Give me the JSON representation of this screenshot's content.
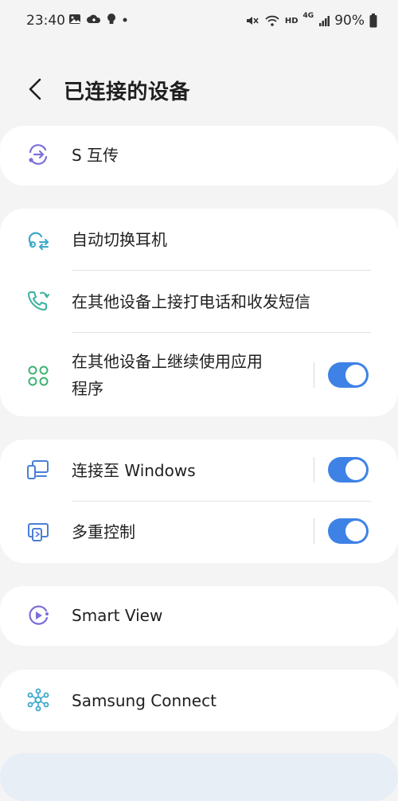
{
  "status_bar": {
    "time": "23:40",
    "battery": "90%",
    "signal_tag": "4G",
    "hd_tag": "HD"
  },
  "header": {
    "title": "已连接的设备"
  },
  "items": {
    "s_transfer": {
      "label": "S 互传"
    },
    "auto_switch": {
      "label": "自动切换耳机"
    },
    "calls_texts": {
      "label": "在其他设备上接打电话和收发短信"
    },
    "continue_apps": {
      "label_line1": "在其他设备上继续使用应用",
      "label_line2": "程序",
      "enabled": true
    },
    "link_windows": {
      "label": "连接至 Windows",
      "enabled": true
    },
    "multi_control": {
      "label": "多重控制",
      "enabled": true
    },
    "smart_view": {
      "label": "Smart View"
    },
    "samsung_connect": {
      "label": "Samsung Connect"
    }
  },
  "colors": {
    "toggle_on": "#3e82e6",
    "purple_icon": "#7b6fd8",
    "teal_icon": "#3aa8c8",
    "green_icon": "#3cb371",
    "blue_icon": "#4a7fd6"
  }
}
